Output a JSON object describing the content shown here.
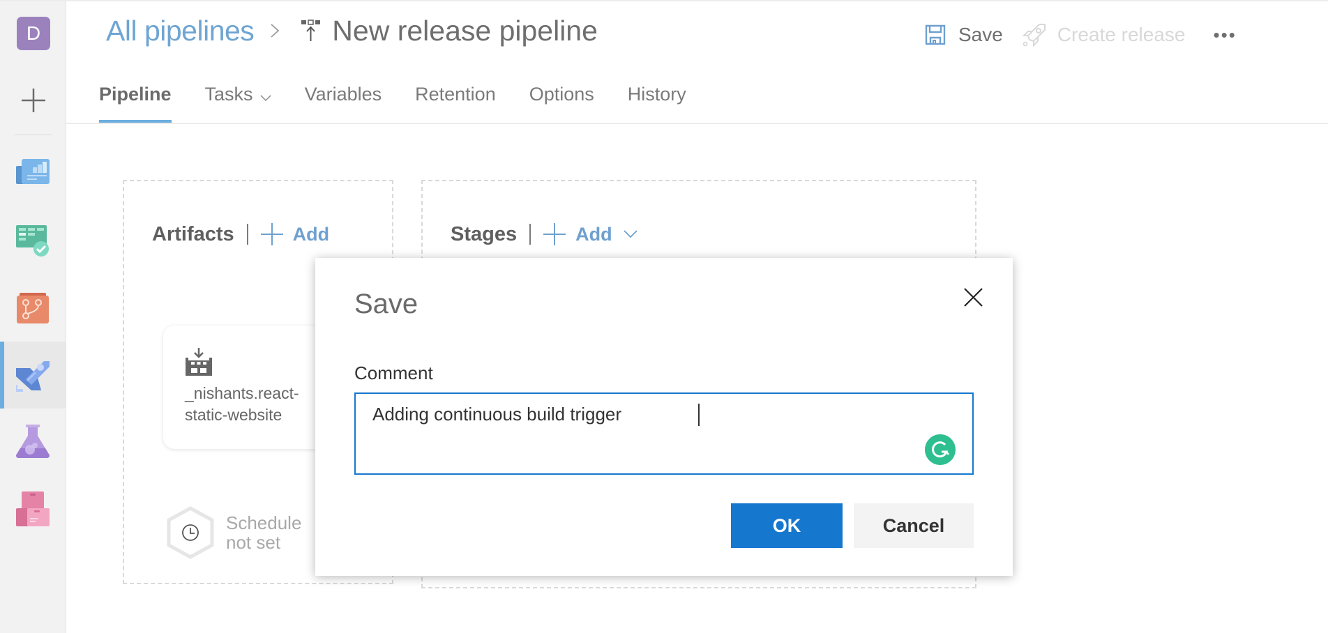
{
  "sidebar": {
    "avatar_letter": "D",
    "new_label": "+",
    "items": [
      {
        "name": "overview",
        "icon": "boards-overview-icon",
        "color": "#6aa9e0"
      },
      {
        "name": "boards",
        "icon": "boards-check-icon",
        "color": "#5cc09a"
      },
      {
        "name": "repos",
        "icon": "repos-icon",
        "color": "#e0785a"
      },
      {
        "name": "pipelines",
        "icon": "pipelines-rocket-icon",
        "color": "#6b8fe0",
        "selected": true
      },
      {
        "name": "test-plans",
        "icon": "test-flask-icon",
        "color": "#9a7bd0"
      },
      {
        "name": "artifacts",
        "icon": "artifacts-package-icon",
        "color": "#e07a9e"
      }
    ]
  },
  "header": {
    "breadcrumb_link": "All pipelines",
    "title": "New release pipeline",
    "toolbar": {
      "save_label": "Save",
      "create_release_label": "Create release",
      "more_label": "•••"
    }
  },
  "tabs": [
    {
      "label": "Pipeline",
      "active": true
    },
    {
      "label": "Tasks",
      "has_dropdown": true
    },
    {
      "label": "Variables"
    },
    {
      "label": "Retention"
    },
    {
      "label": "Options"
    },
    {
      "label": "History"
    }
  ],
  "canvas": {
    "artifacts": {
      "title": "Artifacts",
      "add_label": "Add",
      "card": {
        "name_line1": "_nishants.react-",
        "name_line2": "static-website"
      },
      "schedule": {
        "line1": "Schedule",
        "line2": "not set"
      }
    },
    "stages": {
      "title": "Stages",
      "add_label": "Add"
    }
  },
  "dialog": {
    "title": "Save",
    "comment_label": "Comment",
    "comment_value": "Adding continuous build trigger ",
    "ok_label": "OK",
    "cancel_label": "Cancel"
  },
  "colors": {
    "accent": "#1677ce",
    "link": "#6ea0cf",
    "selected_bar": "#6caee0",
    "grammarly": "#2ebf91"
  }
}
